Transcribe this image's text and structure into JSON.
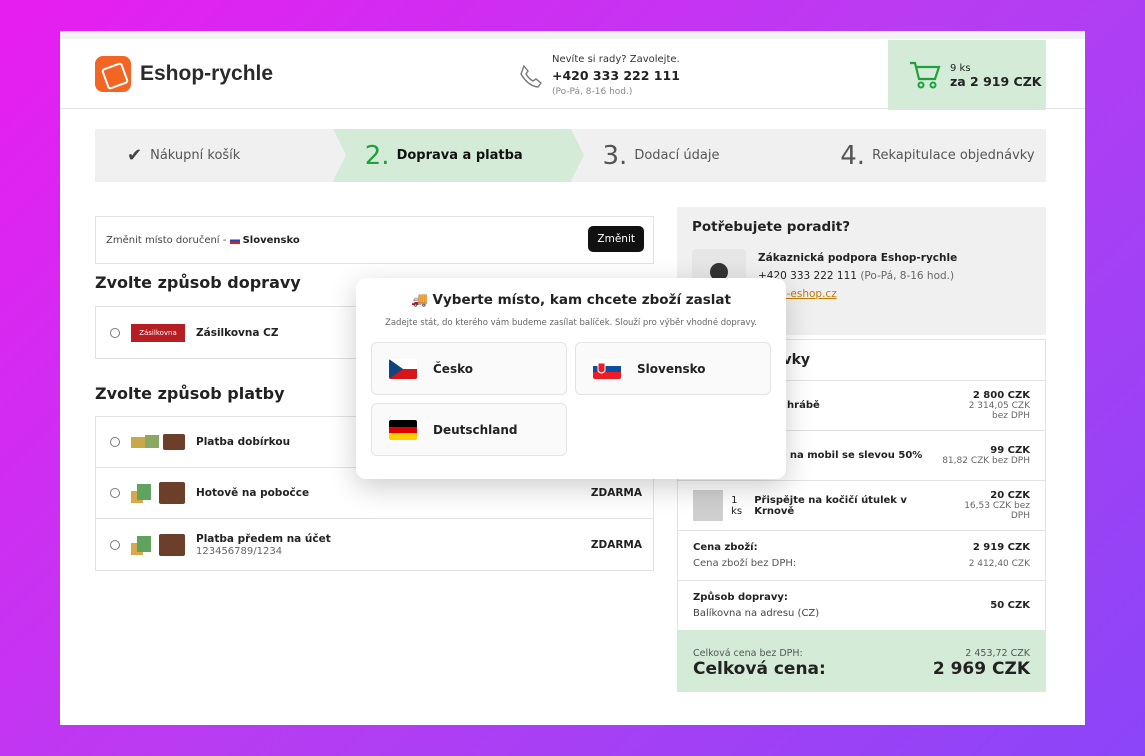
{
  "header": {
    "logo_text": "Eshop-rychle",
    "phone_prompt": "Nevíte si rady? Zavolejte.",
    "phone_number": "+420 333 222 111",
    "phone_hours": "(Po-Pá, 8-16 hod.)",
    "cart_count": "9 ks",
    "cart_total": "za 2 919 CZK"
  },
  "steps": [
    {
      "num": "",
      "label": "Nákupní košík"
    },
    {
      "num": "2.",
      "label": "Doprava a platba"
    },
    {
      "num": "3.",
      "label": "Dodací údaje"
    },
    {
      "num": "4.",
      "label": "Rekapitulace objednávky"
    }
  ],
  "destination": {
    "label": "Změnit místo doručení -",
    "country": "Slovensko",
    "button": "Změnit"
  },
  "shipping": {
    "title": "Zvolte způsob dopravy",
    "options": [
      {
        "label": "Zásilkovna CZ",
        "logo": "Zásilkovna"
      }
    ]
  },
  "payment": {
    "title": "Zvolte způsob platby",
    "options": [
      {
        "label": "Platba dobírkou",
        "sub": "",
        "price": ""
      },
      {
        "label": "Hotově na pobočce",
        "sub": "",
        "price": "ZDARMA"
      },
      {
        "label": "Platba předem na účet",
        "sub": "123456789/1234",
        "price": "ZDARMA"
      }
    ]
  },
  "help": {
    "title": "Potřebujete poradit?",
    "name": "Zákaznická podpora Eshop-rychle",
    "phone": "+420 333 222 111",
    "hours": "(Po-Pá, 8-16 hod.)",
    "email": "@vas-eshop.cz"
  },
  "summary": {
    "title": "ávky",
    "items": [
      {
        "label": "ní hrábě",
        "price": "2 800 CZK",
        "net": "2 314,05 CZK bez DPH"
      },
      {
        "label": "ka na mobil se slevou 50%",
        "price": "99 CZK",
        "net": "81,82 CZK bez DPH"
      },
      {
        "qty": "1 ks",
        "label": "Přispějte na kočičí útulek v Krnově",
        "price": "20 CZK",
        "net": "16,53 CZK bez DPH"
      }
    ],
    "goods_label": "Cena zboží:",
    "goods_price": "2 919 CZK",
    "goods_net_label": "Cena zboží bez DPH:",
    "goods_net": "2 412,40 CZK",
    "ship_label": "Způsob dopravy:",
    "ship_method": "Balíkovna na adresu (CZ)",
    "ship_price": "50 CZK",
    "total_net_label": "Celková cena bez DPH:",
    "total_net": "2 453,72 CZK",
    "total_label": "Celková cena:",
    "total": "2 969 CZK"
  },
  "modal": {
    "icon": "🚚",
    "title": "Vyberte místo, kam chcete zboží zaslat",
    "subtitle": "Zadejte stát, do kterého vám budeme zasílat balíček. Slouží pro výběr vhodné dopravy.",
    "countries": [
      {
        "name": "Česko",
        "flag": "flag-cz"
      },
      {
        "name": "Slovensko",
        "flag": "flag-sk"
      },
      {
        "name": "Deutschland",
        "flag": "flag-de"
      }
    ]
  }
}
